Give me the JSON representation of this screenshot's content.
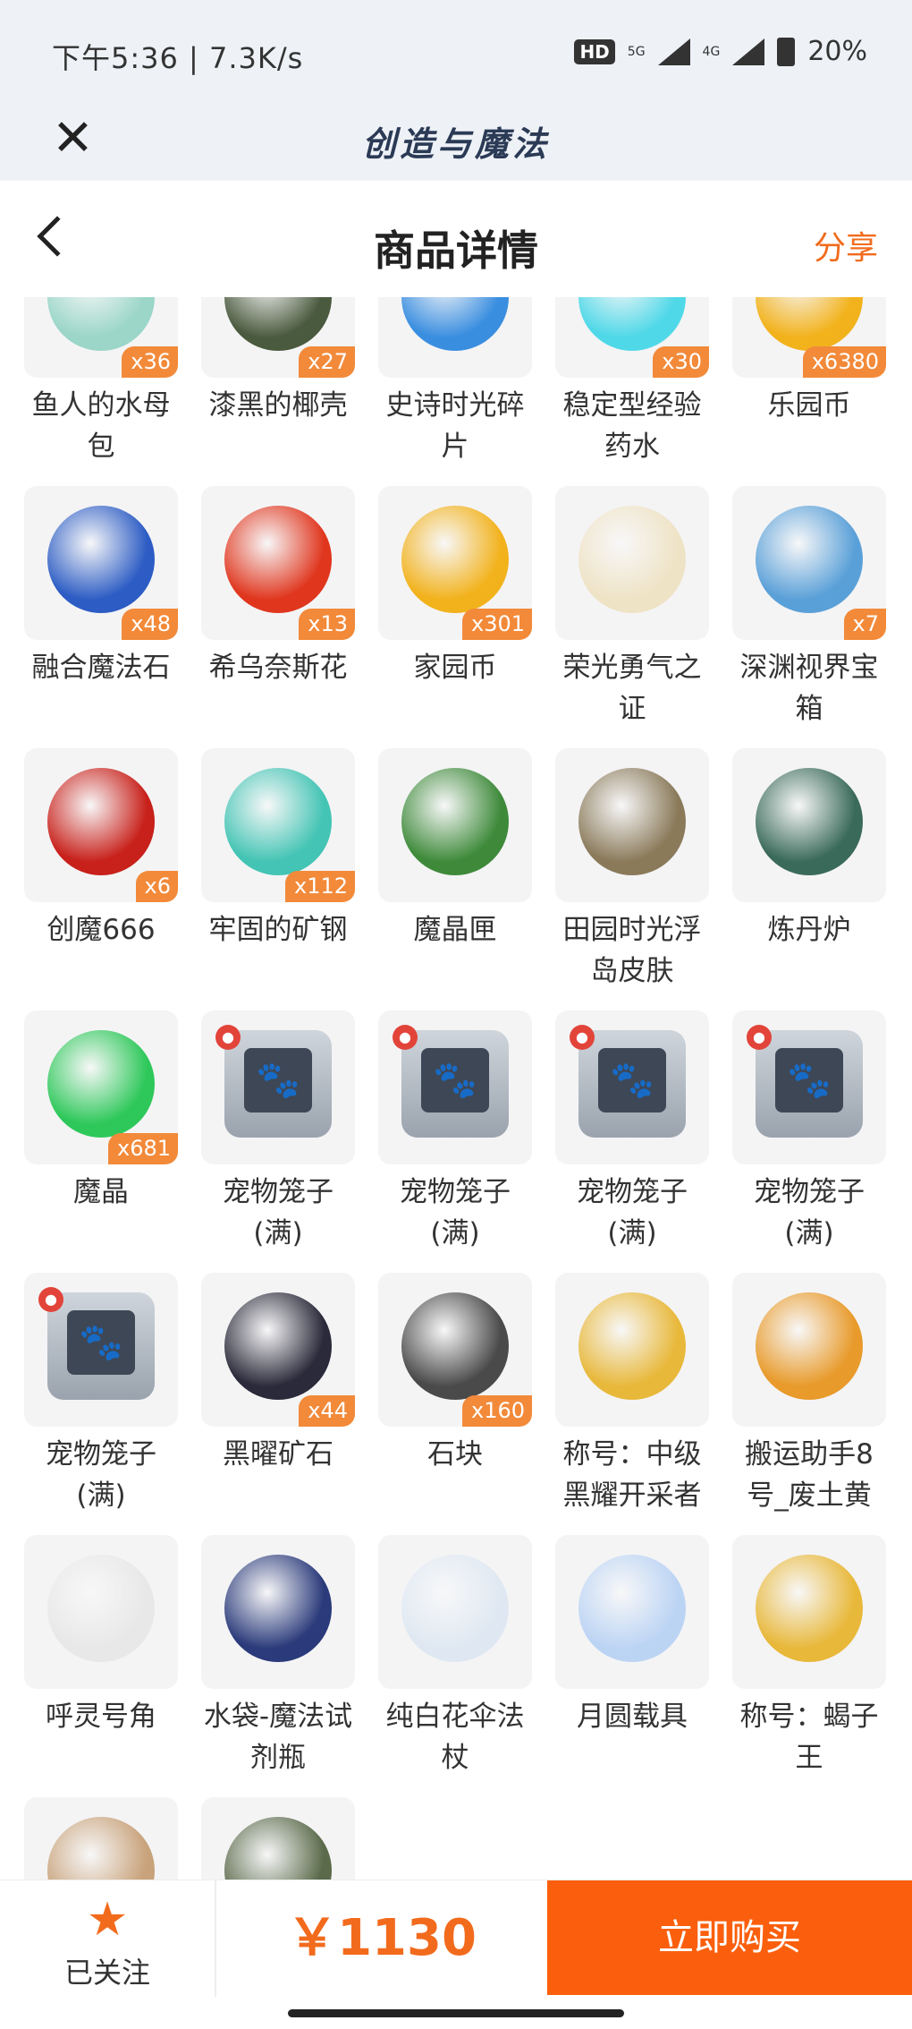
{
  "status_bar": {
    "time": "下午5:36 | 7.3K/s",
    "hd_label": "HD",
    "net1": "5G",
    "net2": "4G",
    "battery": "20%"
  },
  "app_header": {
    "title": "创造与魔法"
  },
  "nav": {
    "title": "商品详情",
    "share_label": "分享"
  },
  "colors": {
    "accent": "#f26b1d",
    "buy_bg": "#fb5f0d",
    "qty_bg": "#f28a3a"
  },
  "items": [
    {
      "name": "鱼人的水母包",
      "qty": "x36",
      "icon": "jellyfish-bag-icon",
      "color": "#9bd6c8"
    },
    {
      "name": "漆黑的椰壳",
      "qty": "x27",
      "icon": "coconut-shell-icon",
      "color": "#4a5a3e"
    },
    {
      "name": "史诗时光碎片",
      "qty": "",
      "icon": "time-shard-icon",
      "color": "#3a8ee0"
    },
    {
      "name": "稳定型经验药水",
      "qty": "x30",
      "icon": "exp-potion-icon",
      "color": "#4fd8e8"
    },
    {
      "name": "乐园币",
      "qty": "x6380",
      "icon": "paradise-coin-icon",
      "color": "#f2b21c"
    },
    {
      "name": "融合魔法石",
      "qty": "x48",
      "icon": "magic-stone-icon",
      "color": "#2c5cc4"
    },
    {
      "name": "希乌奈斯花",
      "qty": "x13",
      "icon": "red-flower-icon",
      "color": "#e0361e"
    },
    {
      "name": "家园币",
      "qty": "x301",
      "icon": "home-coin-icon",
      "color": "#f2b21c"
    },
    {
      "name": "荣光勇气之证",
      "qty": "",
      "icon": "glory-emblem-icon",
      "color": "#efe3c6"
    },
    {
      "name": "深渊视界宝箱",
      "qty": "x7",
      "icon": "abyss-chest-icon",
      "color": "#5aa0d8"
    },
    {
      "name": "创魔666",
      "qty": "x6",
      "icon": "card-666-icon",
      "color": "#c8201a"
    },
    {
      "name": "牢固的矿钢",
      "qty": "x112",
      "icon": "crystal-ore-icon",
      "color": "#43c4b4"
    },
    {
      "name": "魔晶匣",
      "qty": "",
      "icon": "green-chest-icon",
      "color": "#3e8a3a"
    },
    {
      "name": "田园时光浮岛皮肤",
      "qty": "",
      "icon": "floating-island-icon",
      "color": "#8a7a5a"
    },
    {
      "name": "炼丹炉",
      "qty": "",
      "icon": "alchemy-furnace-icon",
      "color": "#3a6a5a"
    },
    {
      "name": "魔晶",
      "qty": "x681",
      "icon": "magic-crystal-icon",
      "color": "#2ec85a"
    },
    {
      "name": "宠物笼子(满)",
      "qty": "",
      "icon": "pet-cage-icon",
      "color": "#4a5566",
      "pet": true
    },
    {
      "name": "宠物笼子(满)",
      "qty": "",
      "icon": "pet-cage-icon",
      "color": "#4a5566",
      "pet": true
    },
    {
      "name": "宠物笼子(满)",
      "qty": "",
      "icon": "pet-cage-icon",
      "color": "#4a5566",
      "pet": true
    },
    {
      "name": "宠物笼子(满)",
      "qty": "",
      "icon": "pet-cage-icon",
      "color": "#4a5566",
      "pet": true
    },
    {
      "name": "宠物笼子(满)",
      "qty": "",
      "icon": "pet-cage-icon",
      "color": "#4a5566",
      "pet": true
    },
    {
      "name": "黑曜矿石",
      "qty": "x44",
      "icon": "obsidian-ore-icon",
      "color": "#2a2a3a"
    },
    {
      "name": "石块",
      "qty": "x160",
      "icon": "stone-icon",
      "color": "#4a4a4a"
    },
    {
      "name": "称号：中级黑耀开采者",
      "qty": "",
      "icon": "title-badge-icon",
      "color": "#e8b83a"
    },
    {
      "name": "搬运助手8号_废土黄",
      "qty": "",
      "icon": "robot-helper-icon",
      "color": "#e89a2a"
    },
    {
      "name": "呼灵号角",
      "qty": "",
      "icon": "horn-icon",
      "color": "#e8e8e8"
    },
    {
      "name": "水袋-魔法试剂瓶",
      "qty": "",
      "icon": "magic-flask-icon",
      "color": "#2a3a7a"
    },
    {
      "name": "纯白花伞法杖",
      "qty": "",
      "icon": "umbrella-staff-icon",
      "color": "#dfe8f2"
    },
    {
      "name": "月圆载具",
      "qty": "",
      "icon": "moon-vehicle-icon",
      "color": "#bcd4f4"
    },
    {
      "name": "称号：蝎子王",
      "qty": "",
      "icon": "title-badge-icon",
      "color": "#e8b83a"
    },
    {
      "name": "",
      "qty": "",
      "icon": "envelope-icon",
      "color": "#c8a27a"
    },
    {
      "name": "",
      "qty": "",
      "icon": "ammo-crate-icon",
      "color": "#5a6a4a"
    }
  ],
  "bottom": {
    "follow_label": "已关注",
    "price": "￥1130",
    "buy_label": "立即购买"
  }
}
